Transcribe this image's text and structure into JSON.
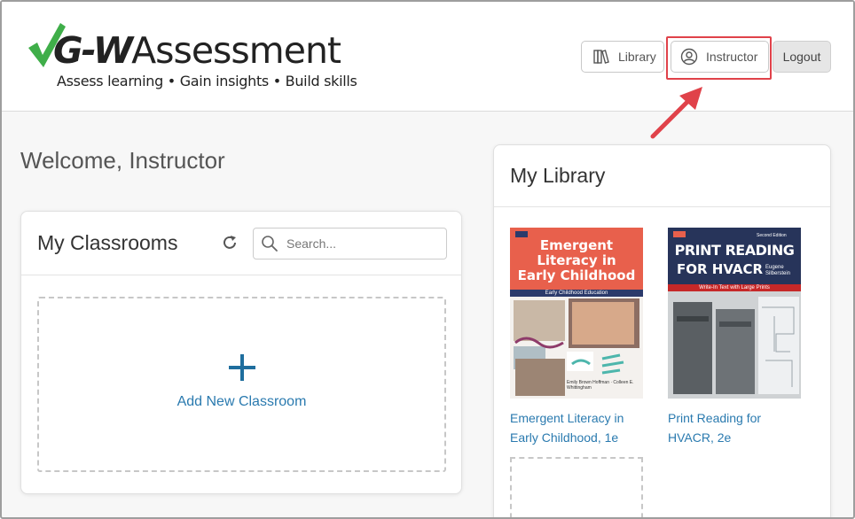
{
  "logo": {
    "brand_prefix": "G-W",
    "brand_suffix": "Assessment",
    "tagline": "Assess learning • Gain insights • Build skills",
    "check_color": "#3fae49"
  },
  "header": {
    "library_label": "Library",
    "instructor_label": "Instructor",
    "logout_label": "Logout",
    "highlight_color": "#e0424a"
  },
  "welcome": "Welcome, Instructor",
  "classrooms": {
    "title": "My Classrooms",
    "search_placeholder": "Search...",
    "add_label": "Add New Classroom",
    "accent_color": "#2a7aaf"
  },
  "library": {
    "title": "My Library",
    "books": [
      {
        "title": "Emergent Literacy in Early Childhood, 1e",
        "cover_title": "Emergent Literacy in Early Childhood",
        "cover_subtitle": "Early Childhood Education",
        "cover_authors": "Emily Brown Hoffman · Colleen E. Whittingham",
        "cover_color": "#e8604c"
      },
      {
        "title": "Print Reading for HVACR, 2e",
        "cover_title_line1": "PRINT READING",
        "cover_title_line2": "FOR HVACR",
        "cover_edition": "Second Edition",
        "cover_author": "Eugene Silberstein",
        "cover_subtitle": "Write-In Text with Large Prints",
        "cover_color": "#27345a"
      }
    ]
  }
}
